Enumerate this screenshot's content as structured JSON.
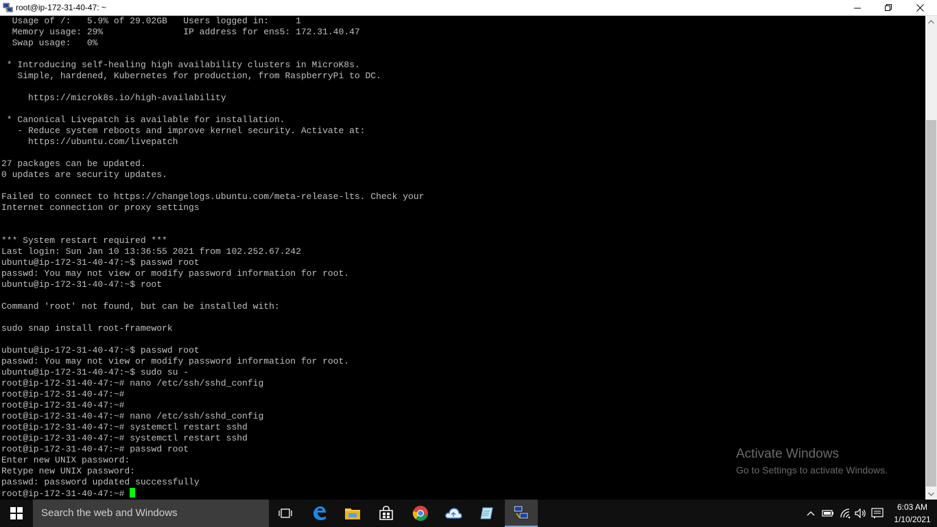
{
  "window": {
    "title": "root@ip-172-31-40-47: ~",
    "icon": "putty-icon"
  },
  "terminal": {
    "lines": [
      "  Usage of /:   5.9% of 29.02GB   Users logged in:     1",
      "  Memory usage: 29%               IP address for ens5: 172.31.40.47",
      "  Swap usage:   0%",
      "",
      " * Introducing self-healing high availability clusters in MicroK8s.",
      "   Simple, hardened, Kubernetes for production, from RaspberryPi to DC.",
      "",
      "     https://microk8s.io/high-availability",
      "",
      " * Canonical Livepatch is available for installation.",
      "   - Reduce system reboots and improve kernel security. Activate at:",
      "     https://ubuntu.com/livepatch",
      "",
      "27 packages can be updated.",
      "0 updates are security updates.",
      "",
      "Failed to connect to https://changelogs.ubuntu.com/meta-release-lts. Check your",
      "Internet connection or proxy settings",
      "",
      "",
      "*** System restart required ***",
      "Last login: Sun Jan 10 13:36:55 2021 from 102.252.67.242",
      "ubuntu@ip-172-31-40-47:~$ passwd root",
      "passwd: You may not view or modify password information for root.",
      "ubuntu@ip-172-31-40-47:~$ root",
      "",
      "Command 'root' not found, but can be installed with:",
      "",
      "sudo snap install root-framework",
      "",
      "ubuntu@ip-172-31-40-47:~$ passwd root",
      "passwd: You may not view or modify password information for root.",
      "ubuntu@ip-172-31-40-47:~$ sudo su -",
      "root@ip-172-31-40-47:~# nano /etc/ssh/sshd_config",
      "root@ip-172-31-40-47:~#",
      "root@ip-172-31-40-47:~#",
      "root@ip-172-31-40-47:~# nano /etc/ssh/sshd_config",
      "root@ip-172-31-40-47:~# systemctl restart sshd",
      "root@ip-172-31-40-47:~# systemctl restart sshd",
      "root@ip-172-31-40-47:~# passwd root",
      "Enter new UNIX password:",
      "Retype new UNIX password:",
      "passwd: password updated successfully"
    ],
    "prompt": "root@ip-172-31-40-47:~# ",
    "cursor_color": "#00ff00"
  },
  "watermark": {
    "title": "Activate Windows",
    "subtitle": "Go to Settings to activate Windows."
  },
  "taskbar": {
    "search_placeholder": "Search the web and Windows",
    "apps": [
      "task-view-icon",
      "edge-icon",
      "file-explorer-icon",
      "store-icon",
      "chrome-icon",
      "cloud-app-icon",
      "notepad-icon",
      "putty-icon"
    ],
    "active_app": "putty-icon",
    "tray_icons": [
      "show-hidden-icons-chevron-icon",
      "battery-icon",
      "wifi-icon",
      "volume-icon",
      "action-center-icon"
    ],
    "time": "6:03 AM",
    "date": "1/10/2021"
  }
}
